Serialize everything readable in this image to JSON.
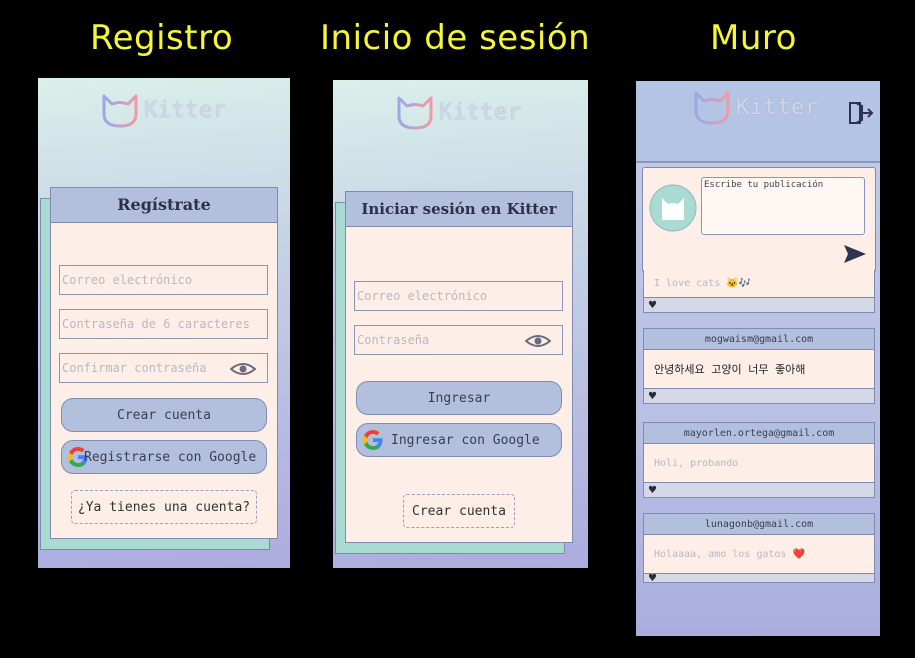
{
  "titles": {
    "registro": "Registro",
    "login": "Inicio de sesión",
    "muro": "Muro"
  },
  "brand": "Kitter",
  "register": {
    "heading": "Regístrate",
    "email_placeholder": "Correo electrónico",
    "password_placeholder": "Contraseña de 6 caracteres",
    "confirm_placeholder": "Confirmar contraseña",
    "create_button": "Crear cuenta",
    "google_button": "Registrarse con Google",
    "have_account": "¿Ya tienes una cuenta?"
  },
  "login": {
    "heading": "Iniciar sesión en Kitter",
    "email_placeholder": "Correo electrónico",
    "password_placeholder": "Contraseña",
    "login_button": "Ingresar",
    "google_button": "Ingresar con Google",
    "create_account": "Crear cuenta"
  },
  "wall": {
    "compose_placeholder": "Escribe tu publicación",
    "posts": [
      {
        "author": "",
        "text": "I love cats 🐱🎶",
        "like": "♥"
      },
      {
        "author": "mogwaism@gmail.com",
        "text": "안녕하세요 고양이 너무 좋아해",
        "like": "♥"
      },
      {
        "author": "mayorlen.ortega@gmail.com",
        "text": "Holi, probando",
        "like": "♥"
      },
      {
        "author": "lunagonb@gmail.com",
        "text": "Holaaaa, amo los gatos ❤️",
        "like": "♥"
      }
    ]
  },
  "icons": {
    "cat_logo": "cat-head-outline-icon",
    "google": "google-g-icon",
    "eye": "eye-icon",
    "send": "send-arrow-icon",
    "logout": "logout-icon",
    "avatar": "cat-avatar-icon",
    "heart": "heart-icon"
  },
  "colors": {
    "title_yellow": "#f5f53b",
    "card_bg": "#fdeee8",
    "header_blue": "#b3c0dd",
    "teal_back": "#a9dbd3"
  }
}
